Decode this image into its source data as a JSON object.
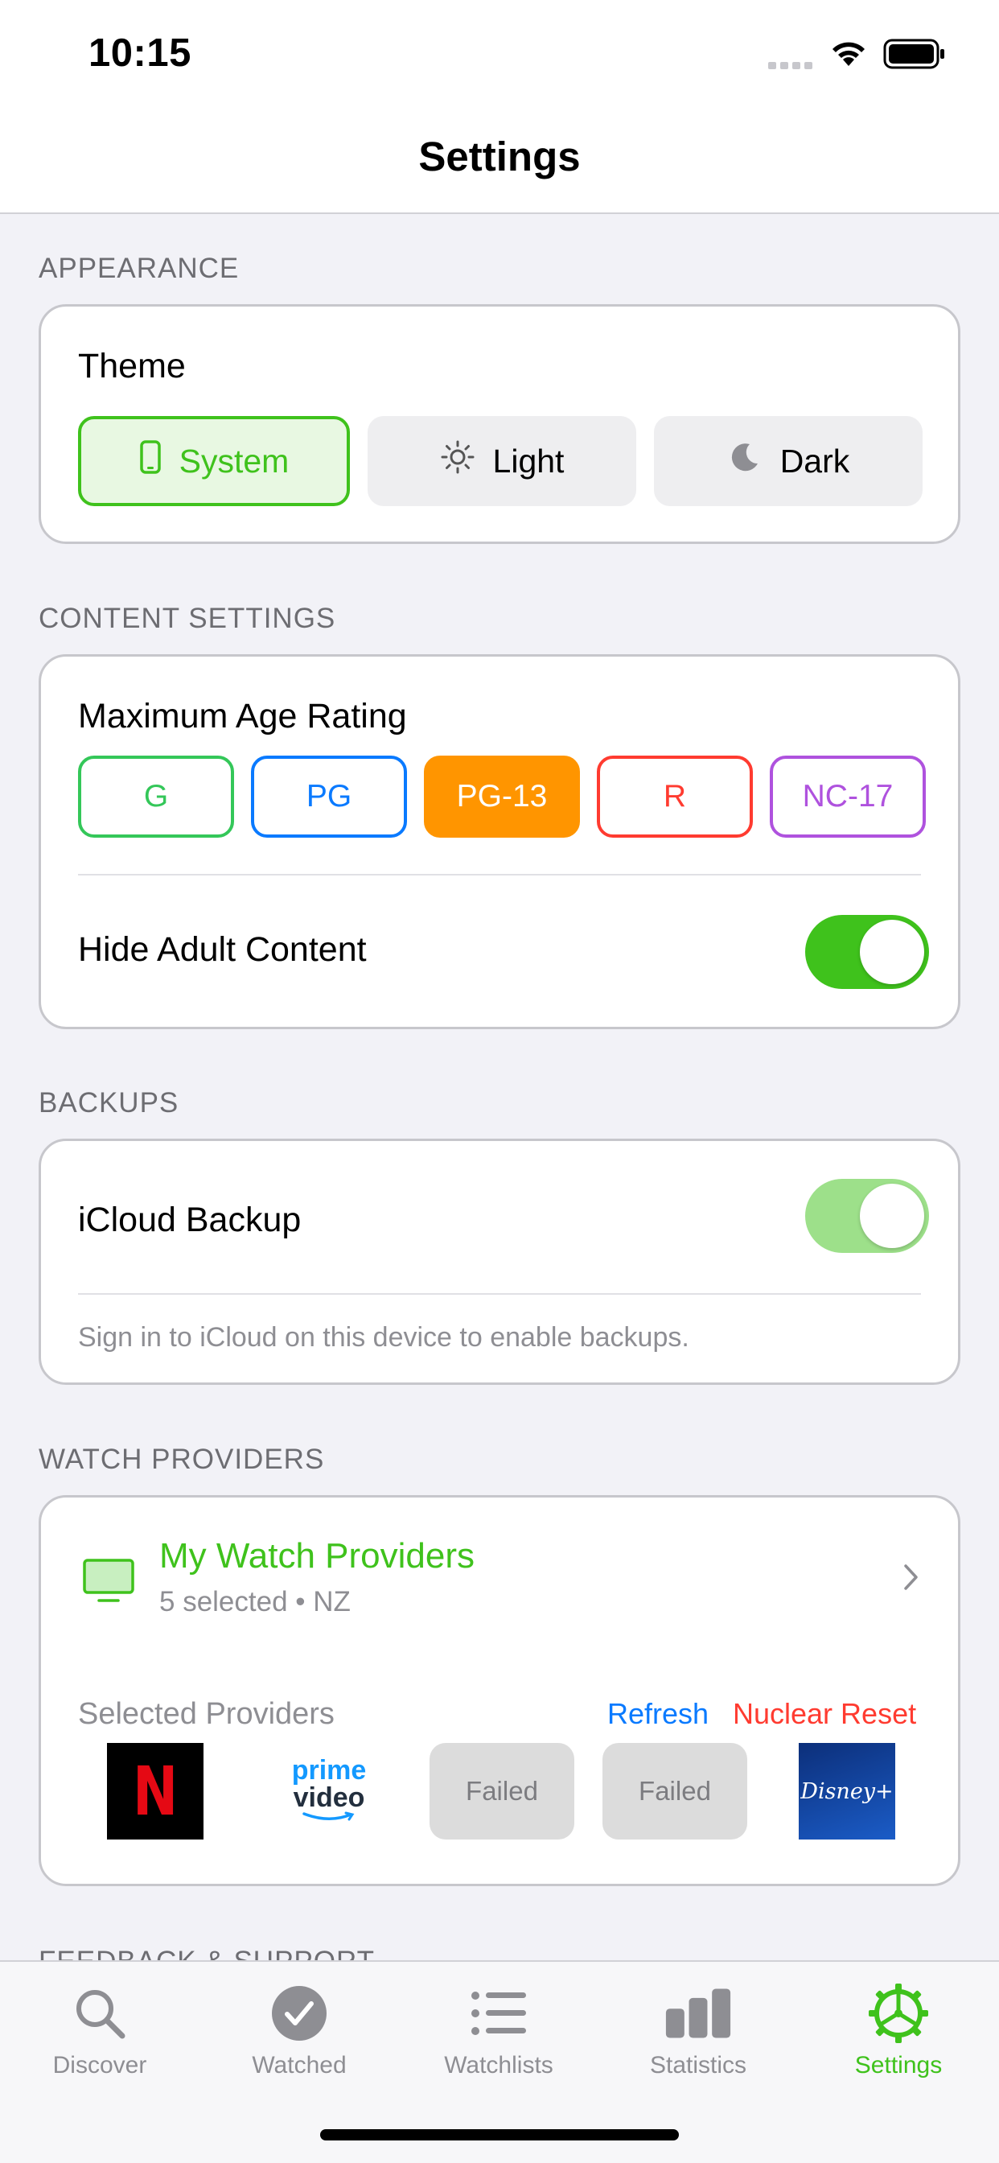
{
  "status_bar": {
    "time": "10:15"
  },
  "header": {
    "title": "Settings"
  },
  "appearance": {
    "section_label": "APPEARANCE",
    "theme_label": "Theme",
    "options": [
      {
        "label": "System",
        "icon": "phone-icon",
        "selected": true
      },
      {
        "label": "Light",
        "icon": "sun-icon",
        "selected": false
      },
      {
        "label": "Dark",
        "icon": "moon-icon",
        "selected": false
      }
    ]
  },
  "content_settings": {
    "section_label": "CONTENT SETTINGS",
    "age_rating_label": "Maximum Age Rating",
    "ratings": [
      {
        "label": "G",
        "color": "#34c759",
        "selected": false
      },
      {
        "label": "PG",
        "color": "#0a7aff",
        "selected": false
      },
      {
        "label": "PG-13",
        "color": "#ff9500",
        "selected": true
      },
      {
        "label": "R",
        "color": "#ff3b30",
        "selected": false
      },
      {
        "label": "NC-17",
        "color": "#af52de",
        "selected": false
      }
    ],
    "hide_adult_label": "Hide Adult Content",
    "hide_adult_on": true
  },
  "backups": {
    "section_label": "BACKUPS",
    "icloud_label": "iCloud Backup",
    "icloud_on": true,
    "icloud_disabled": true,
    "note": "Sign in to iCloud on this device to enable backups."
  },
  "watch_providers": {
    "section_label": "WATCH PROVIDERS",
    "my_providers_title": "My Watch Providers",
    "my_providers_subtitle": "5 selected • NZ",
    "selected_label": "Selected Providers",
    "refresh_label": "Refresh",
    "reset_label": "Nuclear Reset",
    "providers": [
      {
        "name": "N",
        "type": "netflix"
      },
      {
        "name": "prime video",
        "line1": "prime",
        "line2": "video",
        "type": "prime"
      },
      {
        "name": "Failed",
        "type": "failed"
      },
      {
        "name": "Failed",
        "type": "failed"
      },
      {
        "name": "Disney+",
        "type": "disney"
      }
    ]
  },
  "next_section_label": "FEEDBACK & SUPPORT",
  "tab_bar": {
    "tabs": [
      {
        "label": "Discover",
        "icon": "search-icon",
        "active": false
      },
      {
        "label": "Watched",
        "icon": "checkmark-circle-icon",
        "active": false
      },
      {
        "label": "Watchlists",
        "icon": "list-icon",
        "active": false
      },
      {
        "label": "Statistics",
        "icon": "bar-chart-icon",
        "active": false
      },
      {
        "label": "Settings",
        "icon": "settings-gear-icon",
        "active": true
      }
    ]
  },
  "colors": {
    "accent": "#3fc21c",
    "link_blue": "#0a7aff",
    "destructive_red": "#ff3b30",
    "toggle_on": "#3fc21c",
    "toggle_disabled": "#9de08a"
  }
}
